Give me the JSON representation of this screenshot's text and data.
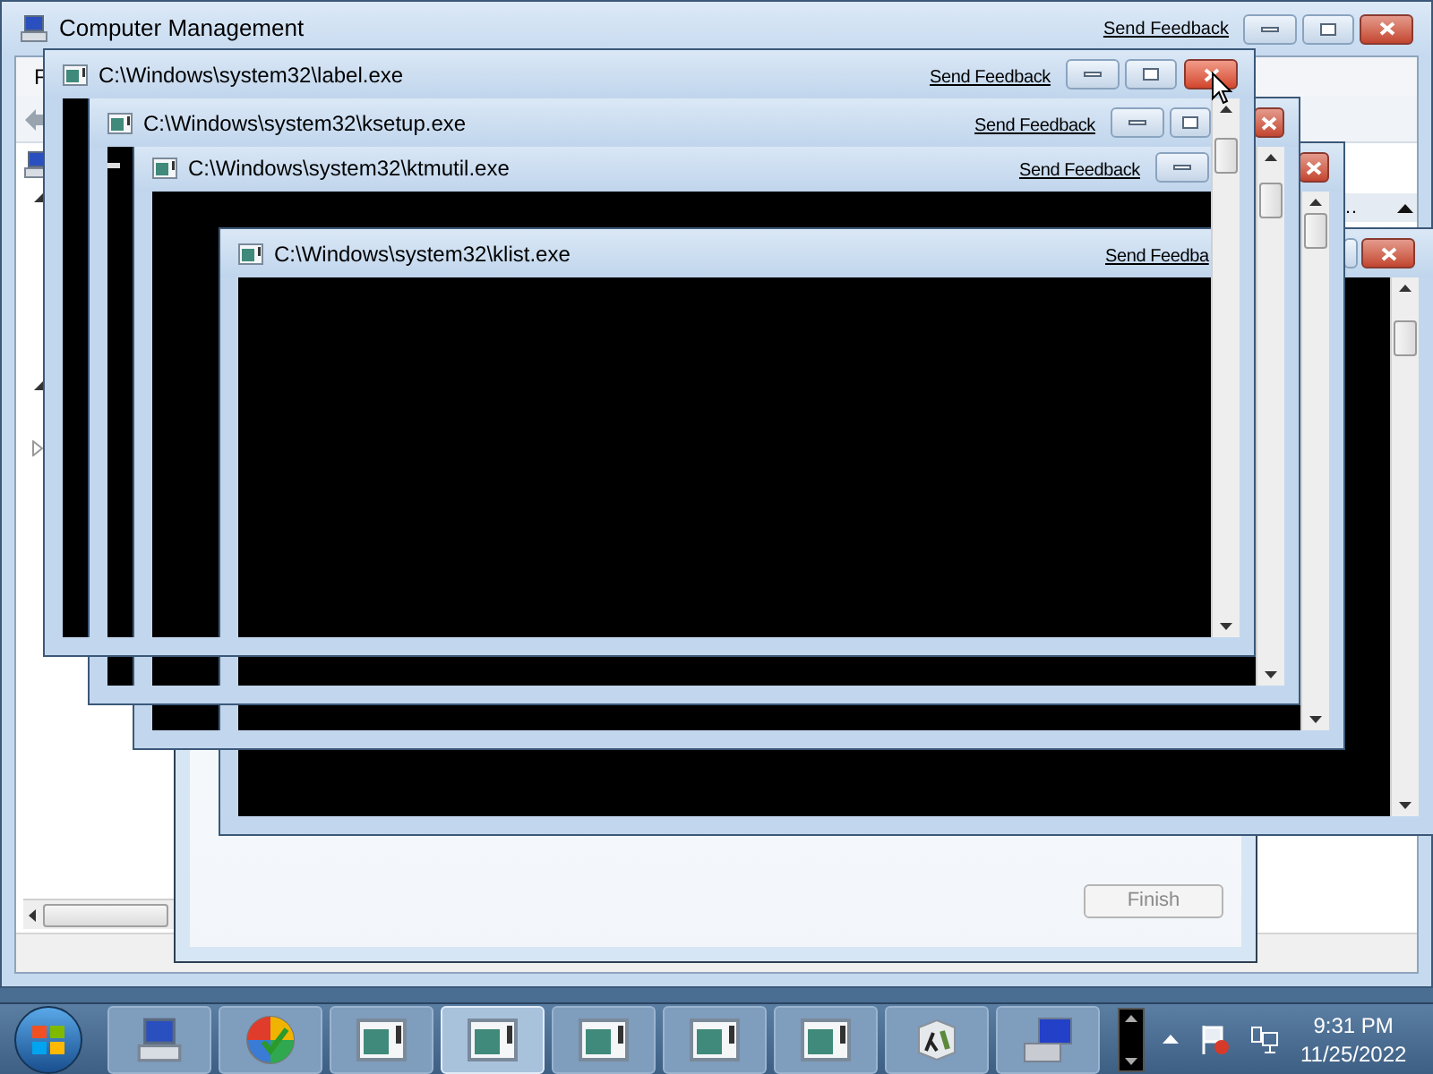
{
  "main_window": {
    "title": "Computer Management",
    "feedback_link": "Send Feedback",
    "menu": [
      "F"
    ],
    "actions_header": "…"
  },
  "wizard": {
    "finish_button": {
      "label": "Finish",
      "disabled": true
    }
  },
  "consoles": [
    {
      "title": "C:\\Windows\\system32\\label.exe",
      "feedback_link": "Send Feedback"
    },
    {
      "title": "C:\\Windows\\system32\\ksetup.exe",
      "feedback_link": "Send Feedback"
    },
    {
      "title": "C:\\Windows\\system32\\ktmutil.exe",
      "feedback_link": "Send Feedback"
    },
    {
      "title": "C:\\Windows\\system32\\klist.exe",
      "feedback_link": "Send Feedba"
    }
  ],
  "taskbar": {
    "items": [
      {
        "kind": "computer",
        "selected": false
      },
      {
        "kind": "ball",
        "selected": false
      },
      {
        "kind": "console",
        "selected": false
      },
      {
        "kind": "console",
        "selected": true
      },
      {
        "kind": "console",
        "selected": false
      },
      {
        "kind": "console",
        "selected": false
      },
      {
        "kind": "console",
        "selected": false
      },
      {
        "kind": "lambda",
        "selected": false
      },
      {
        "kind": "monitor",
        "selected": false
      }
    ],
    "clock": {
      "time": "9:31 PM",
      "date": "11/25/2022"
    }
  }
}
